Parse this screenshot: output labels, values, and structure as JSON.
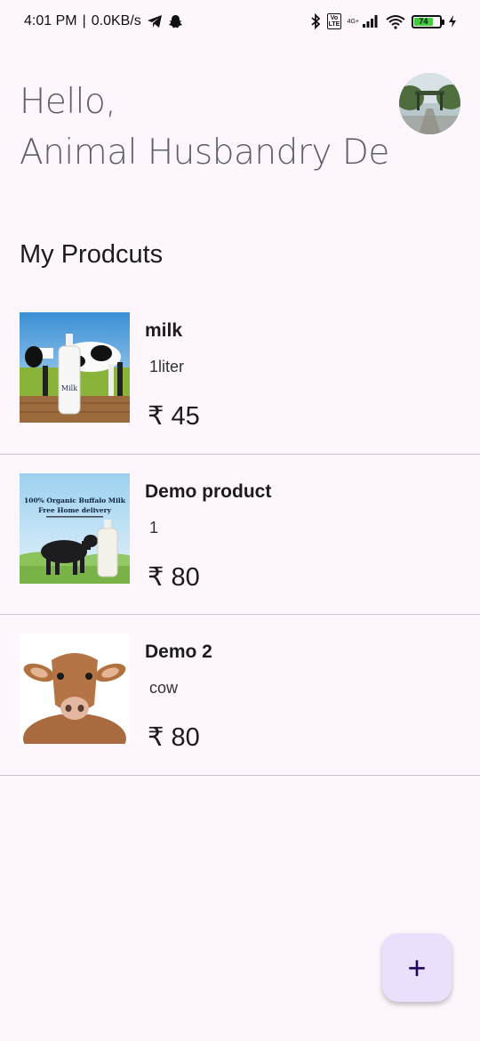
{
  "status_bar": {
    "time": "4:01 PM",
    "speed": "0.0KB/s",
    "volte": "Vo LTE",
    "network": "4G+",
    "battery": "74",
    "battery_level": 0.74
  },
  "greeting": {
    "line1": "Hello,",
    "line2": "Animal Husbandry De"
  },
  "section_title": "My Prodcuts",
  "products": [
    {
      "name": "milk",
      "description": "1liter",
      "price": "₹ 45"
    },
    {
      "name": "Demo product",
      "description": "1",
      "price": "₹ 80",
      "image_text_1": "100% Organic Buffalo  Milk",
      "image_text_2": "Free Home delivery"
    },
    {
      "name": "Demo 2",
      "description": "cow",
      "price": "₹ 80"
    }
  ],
  "milk_bottle_label": "Milk",
  "fab": {
    "label": "+"
  },
  "colors": {
    "background": "#fdf7fd",
    "fab": "#ebe0fb",
    "fab_icon": "#21005d"
  }
}
